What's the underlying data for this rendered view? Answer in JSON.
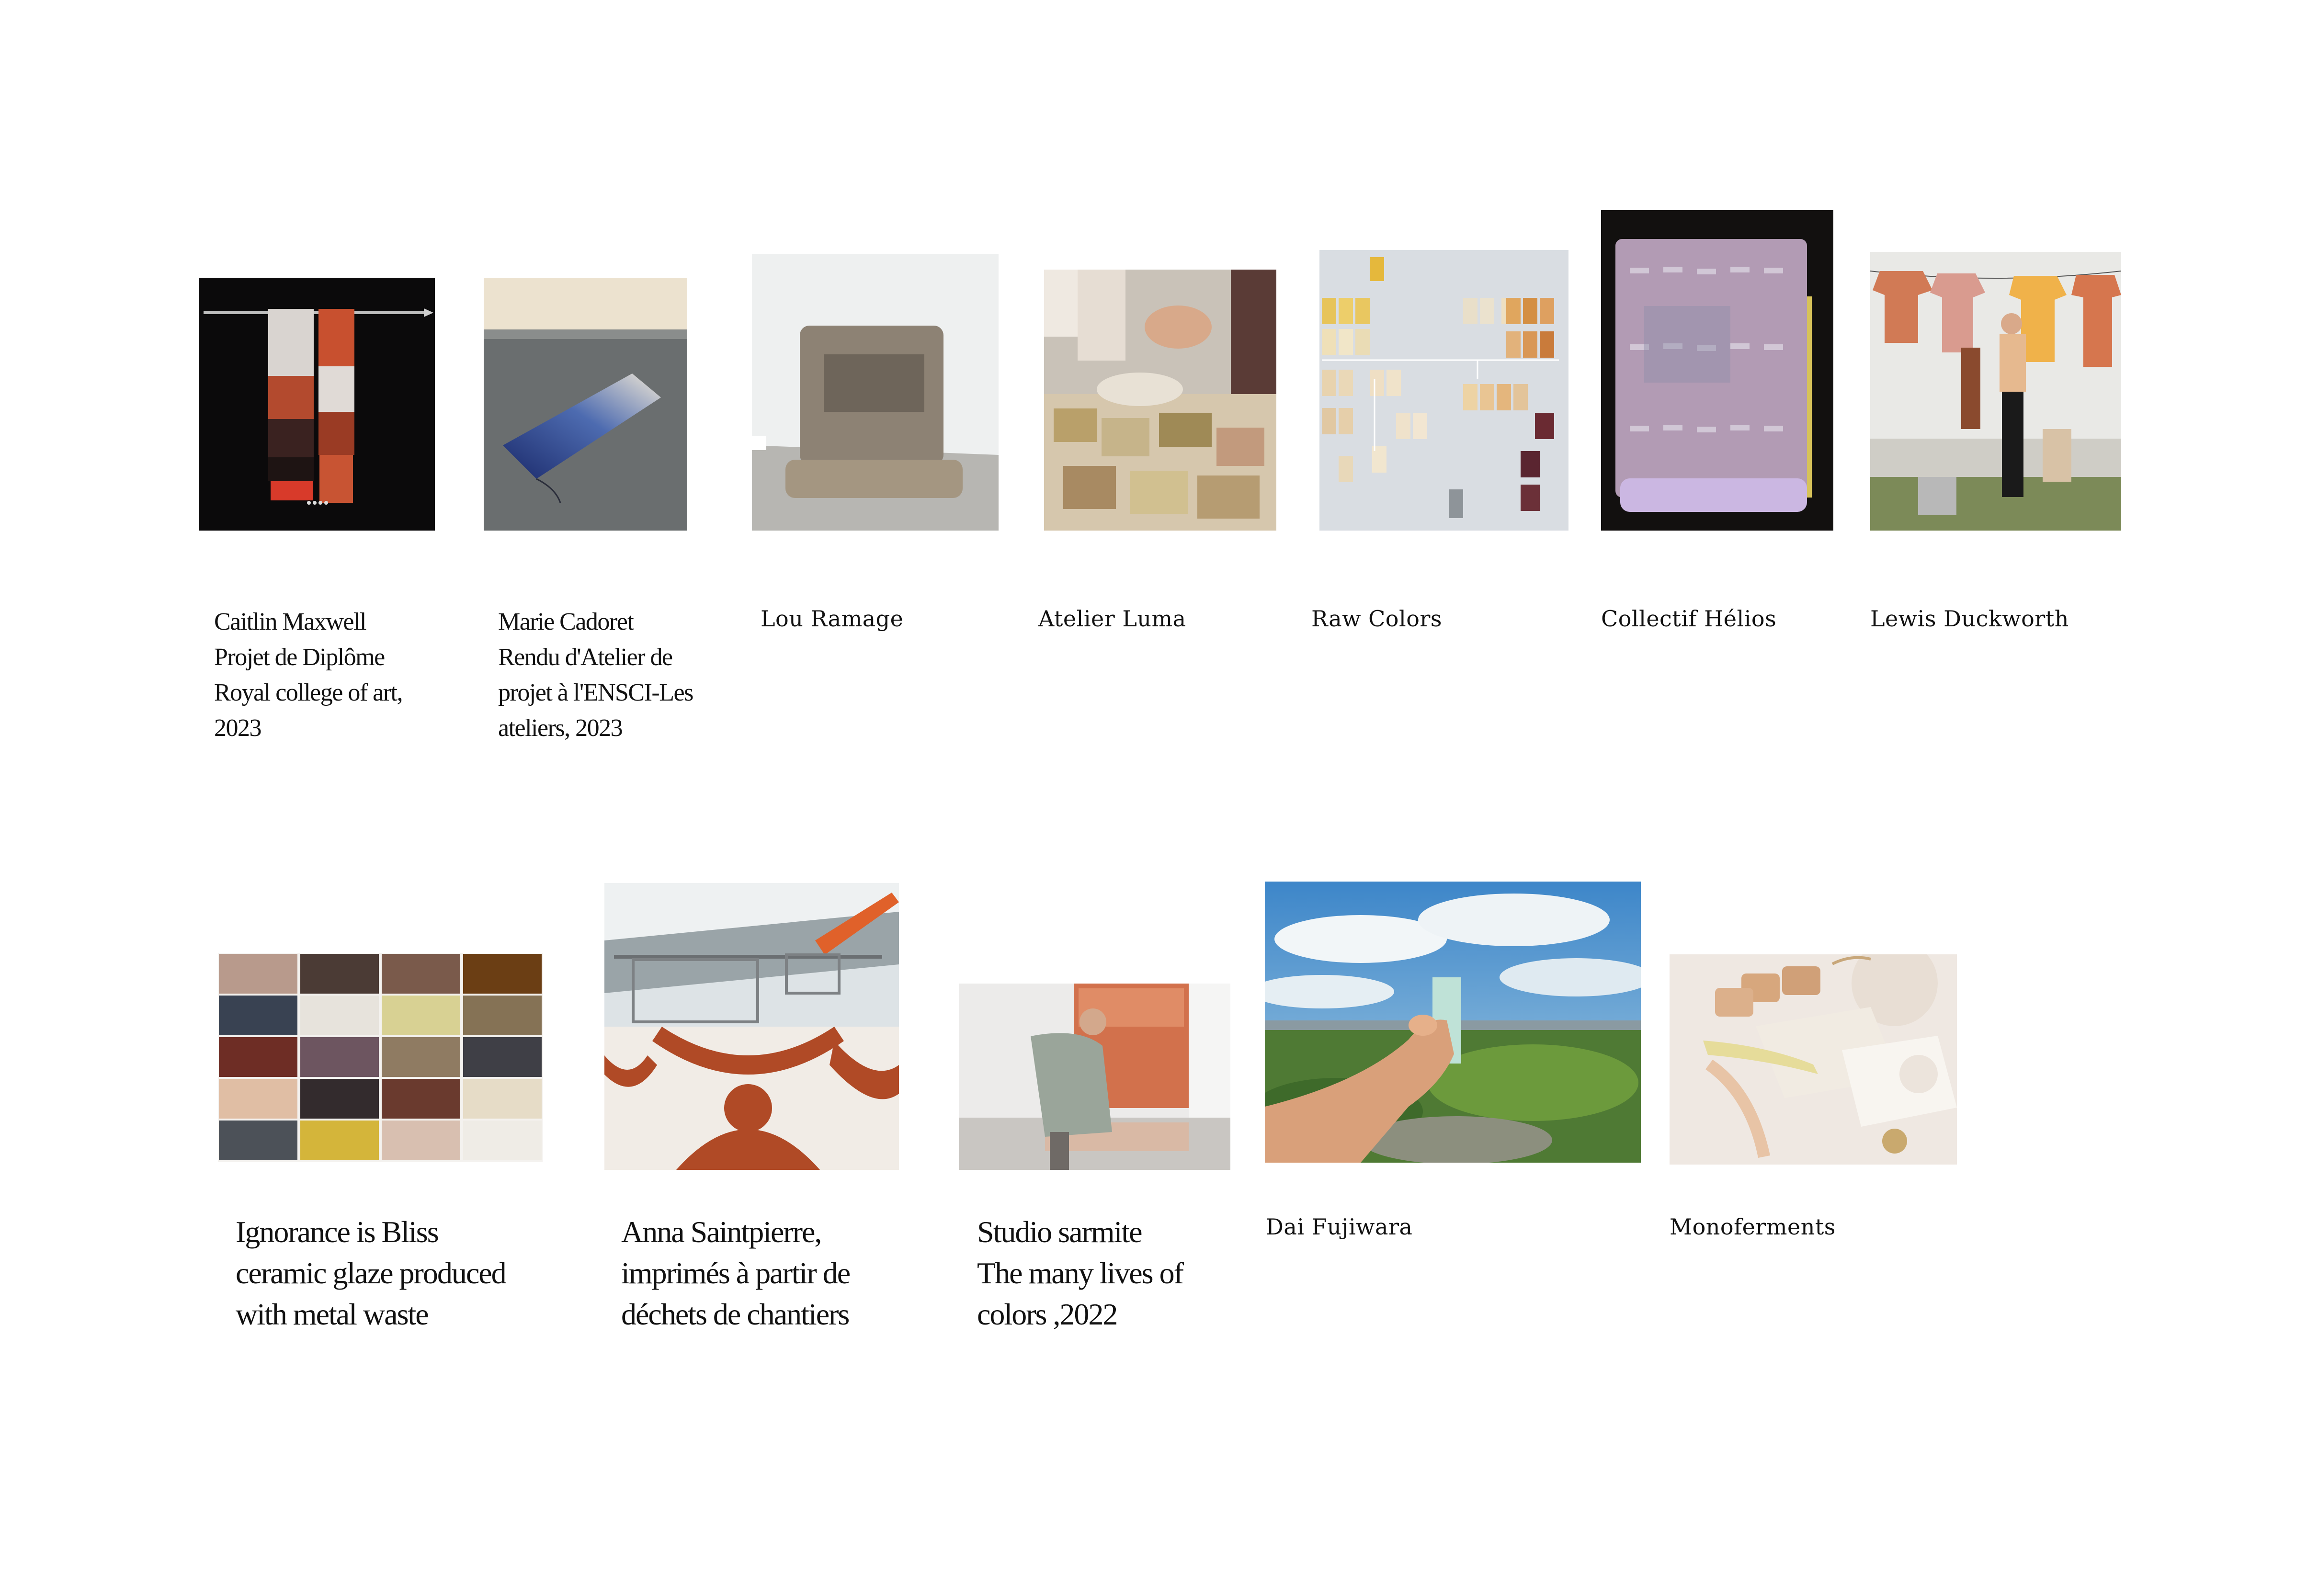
{
  "row1": [
    {
      "name": "caitlin",
      "caption": "Caitlin Maxwell\nProjet de Diplôme\nRoyal college of art,\n2023"
    },
    {
      "name": "marie",
      "caption": "Marie Cadoret\nRendu d'Atelier de\nprojet à l'ENSCI-Les\nateliers, 2023"
    },
    {
      "name": "lou",
      "caption": "Lou Ramage"
    },
    {
      "name": "luma",
      "caption": "Atelier Luma"
    },
    {
      "name": "rawcolors",
      "caption": "Raw Colors"
    },
    {
      "name": "helios",
      "caption": "Collectif Hélios"
    },
    {
      "name": "lewis",
      "caption": "Lewis Duckworth"
    }
  ],
  "row2": [
    {
      "name": "ignorance",
      "caption": "Ignorance is Bliss\nceramic glaze produced\nwith metal waste"
    },
    {
      "name": "anna",
      "caption": "Anna Saintpierre,\nimprimés à partir de\ndéchets de chantiers"
    },
    {
      "name": "sarmite",
      "caption": "Studio sarmite\nThe many lives of\ncolors ,2022"
    },
    {
      "name": "fujiwara",
      "caption": "Dai Fujiwara"
    },
    {
      "name": "monoferments",
      "caption": "Monoferments"
    }
  ],
  "colors": {
    "background": "#ffffff",
    "text": "#111111"
  }
}
